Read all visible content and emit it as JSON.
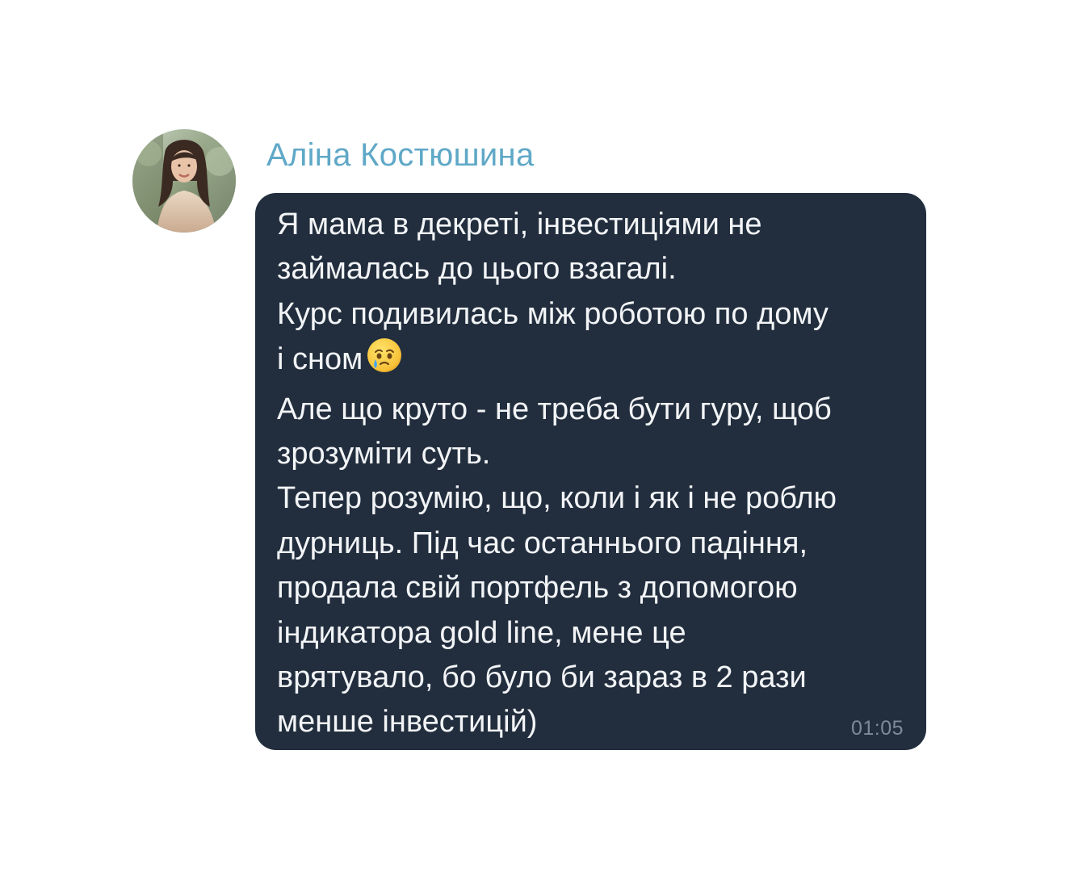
{
  "message": {
    "sender_name": "Аліна Костюшина",
    "lines": [
      "Я мама в декреті, інвестиціями не",
      "займалась до цього взагалі.",
      "Курс подивилась між роботою по дому",
      "і сном",
      "Але що круто - не треба бути гуру, щоб",
      "зрозуміти суть.",
      "Тепер розумію, що, коли і як і не роблю",
      "дурниць. Під час останнього падіння,",
      "продала свій портфель з допомогою",
      "індикатора gold line, мене це",
      "врятувало, бо було би зараз в 2 рази",
      "менше інвестицій)"
    ],
    "emoji_icon": "face-holding-back-tears-icon",
    "time": "01:05"
  },
  "colors": {
    "bubble": "#222e3e",
    "sender_name": "#5fa8c7",
    "message_text": "#f2f4f6",
    "timestamp": "#7e8a99"
  }
}
